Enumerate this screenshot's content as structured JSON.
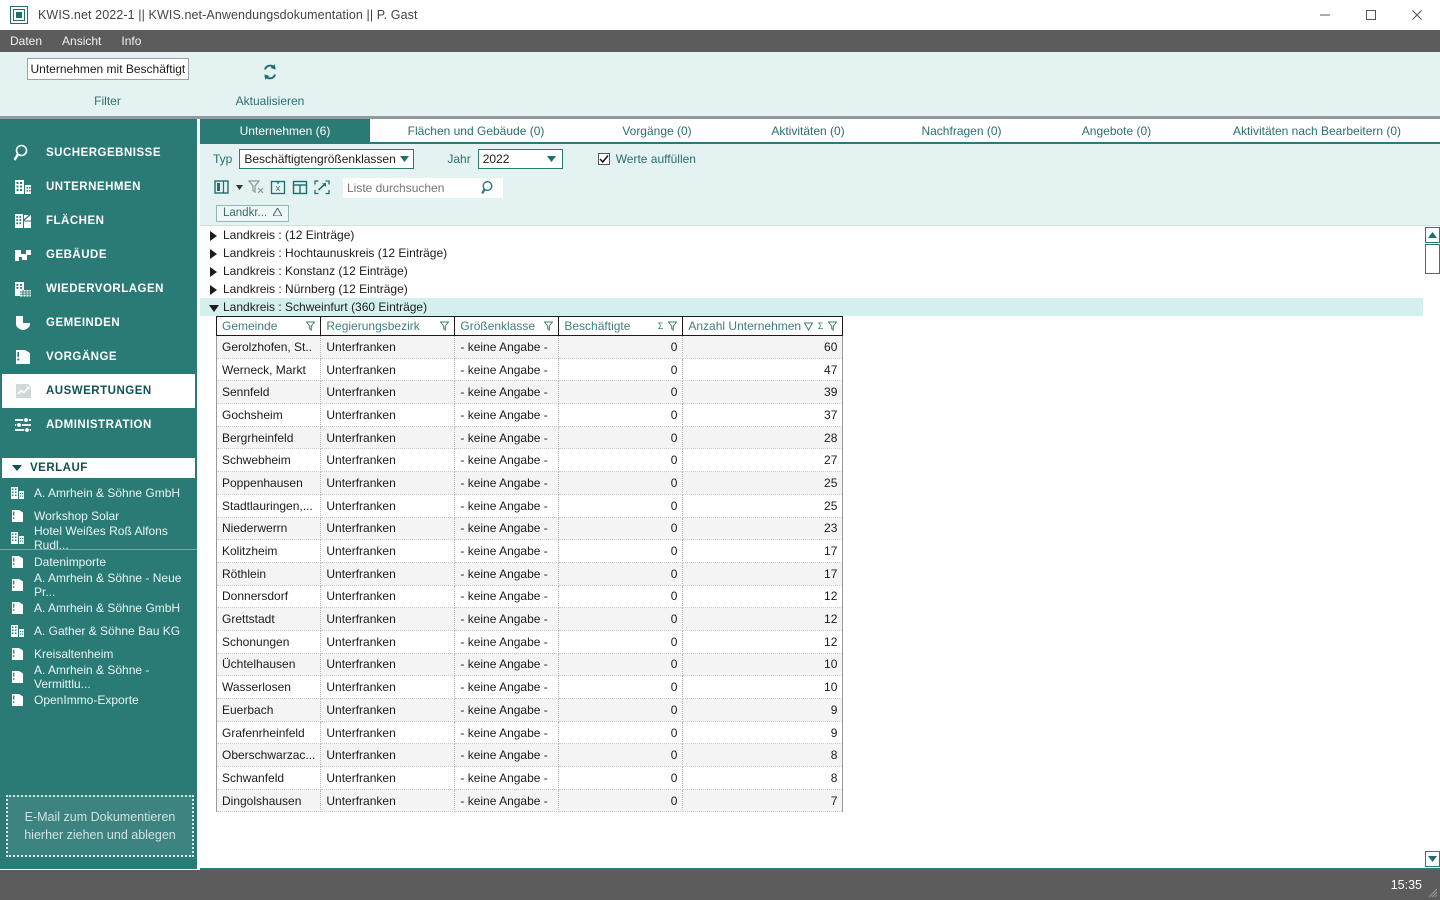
{
  "window": {
    "title": "KWIS.net 2022-1 || KWIS.net-Anwendungsdokumentation || P. Gast",
    "minimize_label": "Minimieren",
    "maximize_label": "Maximieren",
    "close_label": "Schließen"
  },
  "menu": [
    "Daten",
    "Ansicht",
    "Info"
  ],
  "ribbon": {
    "filter_value": "Unternehmen mit Beschäftigte",
    "filter_group_label": "Filter",
    "refresh_label": "Aktualisieren",
    "refresh_icon": "refresh-icon"
  },
  "sidebar": {
    "items": [
      {
        "label": "SUCHERGEBNISSE",
        "icon": "search-icon",
        "active": false
      },
      {
        "label": "UNTERNEHMEN",
        "icon": "building-icon",
        "active": false
      },
      {
        "label": "FLÄCHEN",
        "icon": "areas-icon",
        "active": false
      },
      {
        "label": "GEBÄUDE",
        "icon": "buildings-plan-icon",
        "active": false
      },
      {
        "label": "WIEDERVORLAGEN",
        "icon": "calendar-building-icon",
        "active": false
      },
      {
        "label": "GEMEINDEN",
        "icon": "shield-icon",
        "active": false
      },
      {
        "label": "VORGÄNGE",
        "icon": "folder-icon",
        "active": false
      },
      {
        "label": "AUSWERTUNGEN",
        "icon": "chart-icon",
        "active": true
      },
      {
        "label": "ADMINISTRATION",
        "icon": "sliders-icon",
        "active": false
      }
    ],
    "history_header": "VERLAUF",
    "history": [
      {
        "label": "A. Amrhein & Söhne GmbH",
        "icon": "building-icon"
      },
      {
        "label": "Workshop Solar",
        "icon": "folder-icon"
      },
      {
        "label": "Hotel Weißes Roß Alfons Rudl...",
        "icon": "building-icon"
      },
      {
        "label": "Datenimporte",
        "icon": "folder-icon"
      },
      {
        "label": "A. Amrhein & Söhne - Neue Pr...",
        "icon": "folder-icon"
      },
      {
        "label": "A. Amrhein & Söhne GmbH",
        "icon": "folder-icon"
      },
      {
        "label": "A. Gather & Söhne Bau KG",
        "icon": "building-icon"
      },
      {
        "label": "Kreisaltenheim",
        "icon": "folder-icon"
      },
      {
        "label": "A. Amrhein & Söhne - Vermittlu...",
        "icon": "folder-icon"
      },
      {
        "label": "OpenImmo-Exporte",
        "icon": "folder-icon"
      }
    ],
    "maildrop_line1": "E-Mail  zum Dokumentieren",
    "maildrop_line2": "hierher ziehen und ablegen"
  },
  "tabs": [
    {
      "label": "Unternehmen (6)",
      "active": true
    },
    {
      "label": "Flächen und Gebäude (0)",
      "active": false
    },
    {
      "label": "Vorgänge (0)",
      "active": false
    },
    {
      "label": "Aktivitäten (0)",
      "active": false
    },
    {
      "label": "Nachfragen (0)",
      "active": false
    },
    {
      "label": "Angebote (0)",
      "active": false
    },
    {
      "label": "Aktivitäten nach Bearbeitern (0)",
      "active": false
    }
  ],
  "filters": {
    "typ_label": "Typ",
    "typ_value": "Beschäftigtengrößenklassen",
    "jahr_label": "Jahr",
    "jahr_value": "2022",
    "checkbox_label": "Werte auffüllen",
    "checkbox_checked": true
  },
  "toolbar": {
    "columns_icon": "columns-icon",
    "caret_icon": "chevron-down-icon",
    "clear_filter_icon": "clear-filter-icon",
    "excel_icon": "excel-export-icon",
    "report_icon": "report-icon",
    "expand_icon": "expand-icon",
    "search_placeholder": "Liste durchsuchen",
    "search_value": "",
    "search_icon": "magnifier-icon"
  },
  "grouping": {
    "chip_label": "Landkr...",
    "chip_sort_icon": "sort-asc-icon"
  },
  "grid": {
    "groups": [
      {
        "label": "Landkreis :  (12 Einträge)",
        "expanded": false
      },
      {
        "label": "Landkreis : Hochtaunuskreis (12 Einträge)",
        "expanded": false
      },
      {
        "label": "Landkreis : Konstanz (12 Einträge)",
        "expanded": false
      },
      {
        "label": "Landkreis : Nürnberg (12 Einträge)",
        "expanded": false
      },
      {
        "label": "Landkreis : Schweinfurt (360 Einträge)",
        "expanded": true
      }
    ],
    "columns": [
      {
        "label": "Gemeinde",
        "icons": [
          "filter-icon"
        ]
      },
      {
        "label": "Regierungsbezirk",
        "icons": [
          "filter-icon"
        ]
      },
      {
        "label": "Größenklasse",
        "icons": [
          "filter-icon"
        ]
      },
      {
        "label": "Beschäftigte",
        "icons": [
          "sum-icon",
          "filter-icon"
        ]
      },
      {
        "label": "Anzahl Unternehmen",
        "icons": [
          "sort-desc-icon",
          "sum-icon",
          "filter-icon"
        ]
      }
    ],
    "rows": [
      {
        "gemeinde": "Gerolzhofen, St..",
        "bezirk": "Unterfranken",
        "groesse": "- keine Angabe -",
        "beschaeftigte": "0",
        "anzahl": "60"
      },
      {
        "gemeinde": "Werneck, Markt",
        "bezirk": "Unterfranken",
        "groesse": "- keine Angabe -",
        "beschaeftigte": "0",
        "anzahl": "47"
      },
      {
        "gemeinde": "Sennfeld",
        "bezirk": "Unterfranken",
        "groesse": "- keine Angabe -",
        "beschaeftigte": "0",
        "anzahl": "39"
      },
      {
        "gemeinde": "Gochsheim",
        "bezirk": "Unterfranken",
        "groesse": "- keine Angabe -",
        "beschaeftigte": "0",
        "anzahl": "37"
      },
      {
        "gemeinde": "Bergrheinfeld",
        "bezirk": "Unterfranken",
        "groesse": "- keine Angabe -",
        "beschaeftigte": "0",
        "anzahl": "28"
      },
      {
        "gemeinde": "Schwebheim",
        "bezirk": "Unterfranken",
        "groesse": "- keine Angabe -",
        "beschaeftigte": "0",
        "anzahl": "27"
      },
      {
        "gemeinde": "Poppenhausen",
        "bezirk": "Unterfranken",
        "groesse": "- keine Angabe -",
        "beschaeftigte": "0",
        "anzahl": "25"
      },
      {
        "gemeinde": "Stadtlauringen,...",
        "bezirk": "Unterfranken",
        "groesse": "- keine Angabe -",
        "beschaeftigte": "0",
        "anzahl": "25"
      },
      {
        "gemeinde": "Niederwerrn",
        "bezirk": "Unterfranken",
        "groesse": "- keine Angabe -",
        "beschaeftigte": "0",
        "anzahl": "23"
      },
      {
        "gemeinde": "Kolitzheim",
        "bezirk": "Unterfranken",
        "groesse": "- keine Angabe -",
        "beschaeftigte": "0",
        "anzahl": "17"
      },
      {
        "gemeinde": "Röthlein",
        "bezirk": "Unterfranken",
        "groesse": "- keine Angabe -",
        "beschaeftigte": "0",
        "anzahl": "17"
      },
      {
        "gemeinde": "Donnersdorf",
        "bezirk": "Unterfranken",
        "groesse": "- keine Angabe -",
        "beschaeftigte": "0",
        "anzahl": "12"
      },
      {
        "gemeinde": "Grettstadt",
        "bezirk": "Unterfranken",
        "groesse": "- keine Angabe -",
        "beschaeftigte": "0",
        "anzahl": "12"
      },
      {
        "gemeinde": "Schonungen",
        "bezirk": "Unterfranken",
        "groesse": "- keine Angabe -",
        "beschaeftigte": "0",
        "anzahl": "12"
      },
      {
        "gemeinde": "Üchtelhausen",
        "bezirk": "Unterfranken",
        "groesse": "- keine Angabe -",
        "beschaeftigte": "0",
        "anzahl": "10"
      },
      {
        "gemeinde": "Wasserlosen",
        "bezirk": "Unterfranken",
        "groesse": "- keine Angabe -",
        "beschaeftigte": "0",
        "anzahl": "10"
      },
      {
        "gemeinde": "Euerbach",
        "bezirk": "Unterfranken",
        "groesse": "- keine Angabe -",
        "beschaeftigte": "0",
        "anzahl": "9"
      },
      {
        "gemeinde": "Grafenrheinfeld",
        "bezirk": "Unterfranken",
        "groesse": "- keine Angabe -",
        "beschaeftigte": "0",
        "anzahl": "9"
      },
      {
        "gemeinde": "Oberschwarzac...",
        "bezirk": "Unterfranken",
        "groesse": "- keine Angabe -",
        "beschaeftigte": "0",
        "anzahl": "8"
      },
      {
        "gemeinde": "Schwanfeld",
        "bezirk": "Unterfranken",
        "groesse": "- keine Angabe -",
        "beschaeftigte": "0",
        "anzahl": "8"
      },
      {
        "gemeinde": "Dingolshausen",
        "bezirk": "Unterfranken",
        "groesse": "- keine Angabe -",
        "beschaeftigte": "0",
        "anzahl": "7"
      }
    ]
  },
  "statusbar": {
    "clock": "15:35"
  },
  "colors": {
    "teal": "#2a7a76",
    "teal_dark": "#1f6f6d",
    "ribbon_bg": "#e4f2f1",
    "group_highlight": "#d4f0ee",
    "menu_bg": "#5c5c5c"
  }
}
